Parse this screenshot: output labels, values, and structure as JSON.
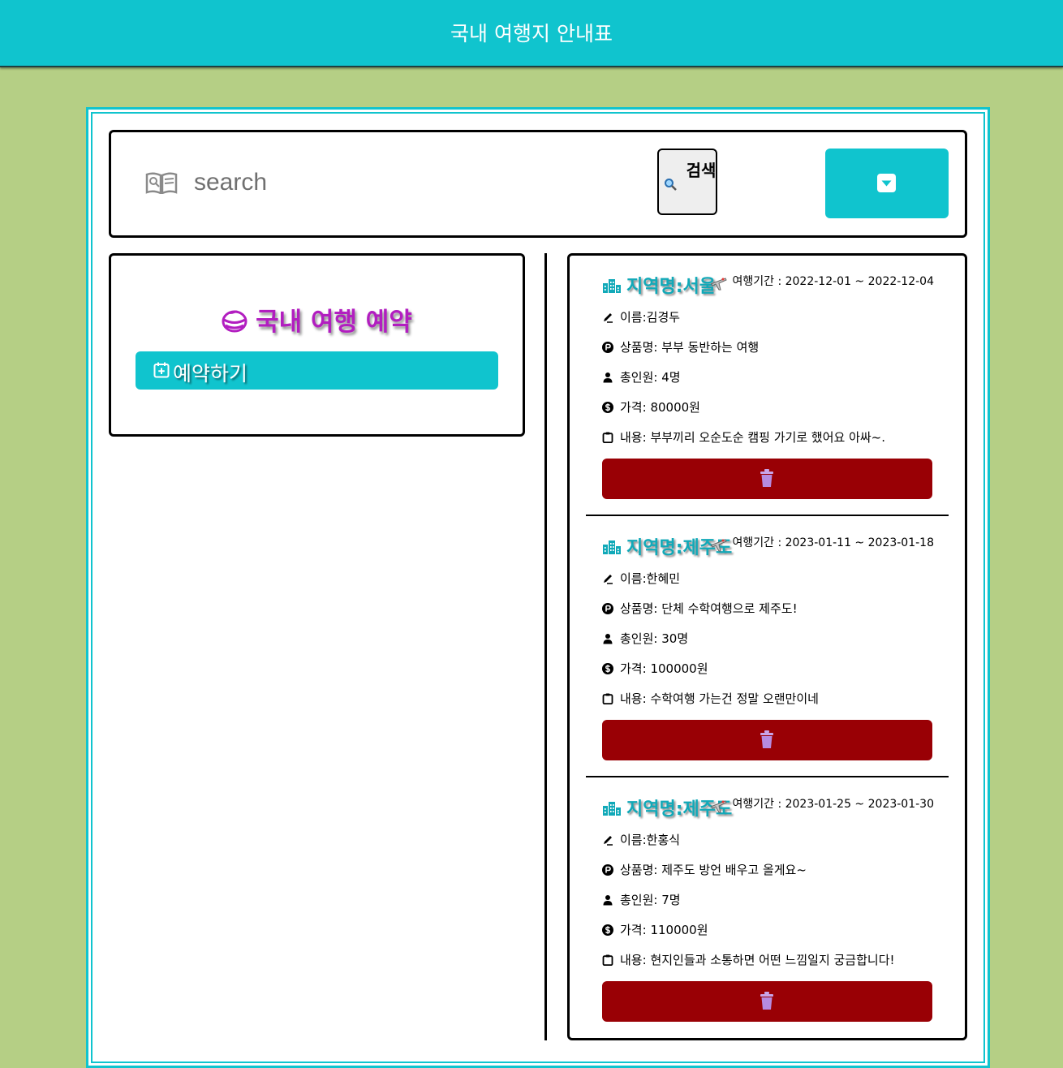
{
  "header": {
    "title": "국내 여행지 안내표"
  },
  "search": {
    "placeholder": "search",
    "button_label": "검색"
  },
  "booking": {
    "title": "국내 여행 예약",
    "reserve_label": "예약하기"
  },
  "labels": {
    "period_prefix": "여행기간 : ",
    "region_prefix": "지역명:",
    "name_prefix": "이름:",
    "product_prefix": "상품명: ",
    "people_prefix": "총인원: ",
    "price_prefix": "가격: ",
    "content_prefix": "내용: "
  },
  "reservations": [
    {
      "region": "서울",
      "period_start": "2022-12-01",
      "period_end": "2022-12-04",
      "name": "김경두",
      "product": "부부 동반하는 여행",
      "people": "4명",
      "price": "80000원",
      "content": "부부끼리 오순도순 캠핑 가기로 했어요 아싸~."
    },
    {
      "region": "제주도",
      "period_start": "2023-01-11",
      "period_end": "2023-01-18",
      "name": "한혜민",
      "product": "단체 수학여행으로 제주도!",
      "people": "30명",
      "price": "100000원",
      "content": "수학여행 가는건 정말 오랜만이네"
    },
    {
      "region": "제주도",
      "period_start": "2023-01-25",
      "period_end": "2023-01-30",
      "name": "한홍식",
      "product": "제주도 방언 배우고 올게요~",
      "people": "7명",
      "price": "110000원",
      "content": "현지인들과 소통하면 어떤 느낌일지 궁금합니다!"
    }
  ],
  "icons": {
    "header": "none",
    "search_field": "open-book-icon",
    "search_button": "magnifier-icon",
    "dropdown": "caret-down-square-icon",
    "booking_title": "globe-icon",
    "reserve": "calendar-plus-icon",
    "region": "city-icon",
    "transport": "airplane-icon",
    "name": "pen-icon",
    "product": "p-circle-icon",
    "people": "person-icon",
    "price": "coin-icon",
    "content": "clipboard-icon",
    "delete": "trash-icon"
  },
  "colors": {
    "background": "#b5cf85",
    "accent": "#10c4ce",
    "delete": "#990005",
    "booking_title": "#b21ec0",
    "region": "#11a9b8"
  }
}
